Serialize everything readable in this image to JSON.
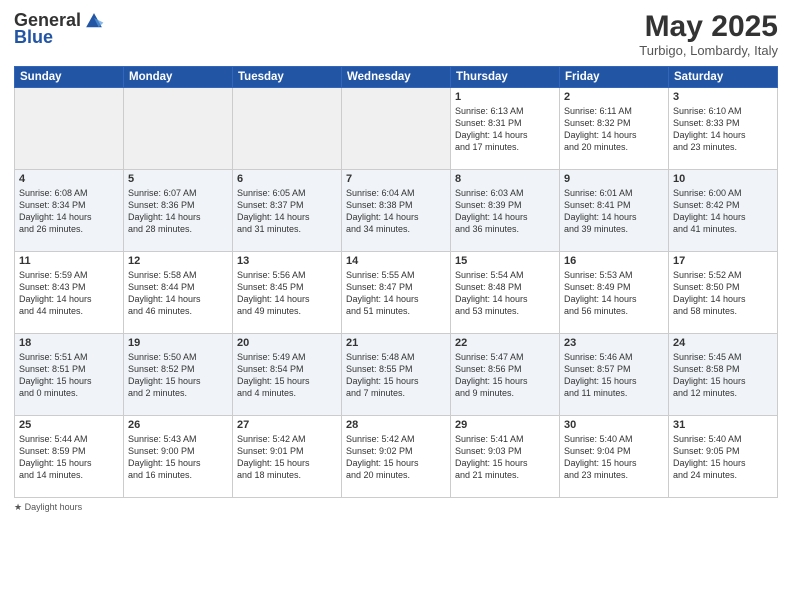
{
  "header": {
    "logo_general": "General",
    "logo_blue": "Blue",
    "month": "May 2025",
    "location": "Turbigo, Lombardy, Italy"
  },
  "footer": {
    "label": "Daylight hours"
  },
  "days_of_week": [
    "Sunday",
    "Monday",
    "Tuesday",
    "Wednesday",
    "Thursday",
    "Friday",
    "Saturday"
  ],
  "weeks": [
    [
      {
        "day": "",
        "info": ""
      },
      {
        "day": "",
        "info": ""
      },
      {
        "day": "",
        "info": ""
      },
      {
        "day": "",
        "info": ""
      },
      {
        "day": "1",
        "info": "Sunrise: 6:13 AM\nSunset: 8:31 PM\nDaylight: 14 hours\nand 17 minutes."
      },
      {
        "day": "2",
        "info": "Sunrise: 6:11 AM\nSunset: 8:32 PM\nDaylight: 14 hours\nand 20 minutes."
      },
      {
        "day": "3",
        "info": "Sunrise: 6:10 AM\nSunset: 8:33 PM\nDaylight: 14 hours\nand 23 minutes."
      }
    ],
    [
      {
        "day": "4",
        "info": "Sunrise: 6:08 AM\nSunset: 8:34 PM\nDaylight: 14 hours\nand 26 minutes."
      },
      {
        "day": "5",
        "info": "Sunrise: 6:07 AM\nSunset: 8:36 PM\nDaylight: 14 hours\nand 28 minutes."
      },
      {
        "day": "6",
        "info": "Sunrise: 6:05 AM\nSunset: 8:37 PM\nDaylight: 14 hours\nand 31 minutes."
      },
      {
        "day": "7",
        "info": "Sunrise: 6:04 AM\nSunset: 8:38 PM\nDaylight: 14 hours\nand 34 minutes."
      },
      {
        "day": "8",
        "info": "Sunrise: 6:03 AM\nSunset: 8:39 PM\nDaylight: 14 hours\nand 36 minutes."
      },
      {
        "day": "9",
        "info": "Sunrise: 6:01 AM\nSunset: 8:41 PM\nDaylight: 14 hours\nand 39 minutes."
      },
      {
        "day": "10",
        "info": "Sunrise: 6:00 AM\nSunset: 8:42 PM\nDaylight: 14 hours\nand 41 minutes."
      }
    ],
    [
      {
        "day": "11",
        "info": "Sunrise: 5:59 AM\nSunset: 8:43 PM\nDaylight: 14 hours\nand 44 minutes."
      },
      {
        "day": "12",
        "info": "Sunrise: 5:58 AM\nSunset: 8:44 PM\nDaylight: 14 hours\nand 46 minutes."
      },
      {
        "day": "13",
        "info": "Sunrise: 5:56 AM\nSunset: 8:45 PM\nDaylight: 14 hours\nand 49 minutes."
      },
      {
        "day": "14",
        "info": "Sunrise: 5:55 AM\nSunset: 8:47 PM\nDaylight: 14 hours\nand 51 minutes."
      },
      {
        "day": "15",
        "info": "Sunrise: 5:54 AM\nSunset: 8:48 PM\nDaylight: 14 hours\nand 53 minutes."
      },
      {
        "day": "16",
        "info": "Sunrise: 5:53 AM\nSunset: 8:49 PM\nDaylight: 14 hours\nand 56 minutes."
      },
      {
        "day": "17",
        "info": "Sunrise: 5:52 AM\nSunset: 8:50 PM\nDaylight: 14 hours\nand 58 minutes."
      }
    ],
    [
      {
        "day": "18",
        "info": "Sunrise: 5:51 AM\nSunset: 8:51 PM\nDaylight: 15 hours\nand 0 minutes."
      },
      {
        "day": "19",
        "info": "Sunrise: 5:50 AM\nSunset: 8:52 PM\nDaylight: 15 hours\nand 2 minutes."
      },
      {
        "day": "20",
        "info": "Sunrise: 5:49 AM\nSunset: 8:54 PM\nDaylight: 15 hours\nand 4 minutes."
      },
      {
        "day": "21",
        "info": "Sunrise: 5:48 AM\nSunset: 8:55 PM\nDaylight: 15 hours\nand 7 minutes."
      },
      {
        "day": "22",
        "info": "Sunrise: 5:47 AM\nSunset: 8:56 PM\nDaylight: 15 hours\nand 9 minutes."
      },
      {
        "day": "23",
        "info": "Sunrise: 5:46 AM\nSunset: 8:57 PM\nDaylight: 15 hours\nand 11 minutes."
      },
      {
        "day": "24",
        "info": "Sunrise: 5:45 AM\nSunset: 8:58 PM\nDaylight: 15 hours\nand 12 minutes."
      }
    ],
    [
      {
        "day": "25",
        "info": "Sunrise: 5:44 AM\nSunset: 8:59 PM\nDaylight: 15 hours\nand 14 minutes."
      },
      {
        "day": "26",
        "info": "Sunrise: 5:43 AM\nSunset: 9:00 PM\nDaylight: 15 hours\nand 16 minutes."
      },
      {
        "day": "27",
        "info": "Sunrise: 5:42 AM\nSunset: 9:01 PM\nDaylight: 15 hours\nand 18 minutes."
      },
      {
        "day": "28",
        "info": "Sunrise: 5:42 AM\nSunset: 9:02 PM\nDaylight: 15 hours\nand 20 minutes."
      },
      {
        "day": "29",
        "info": "Sunrise: 5:41 AM\nSunset: 9:03 PM\nDaylight: 15 hours\nand 21 minutes."
      },
      {
        "day": "30",
        "info": "Sunrise: 5:40 AM\nSunset: 9:04 PM\nDaylight: 15 hours\nand 23 minutes."
      },
      {
        "day": "31",
        "info": "Sunrise: 5:40 AM\nSunset: 9:05 PM\nDaylight: 15 hours\nand 24 minutes."
      }
    ]
  ]
}
